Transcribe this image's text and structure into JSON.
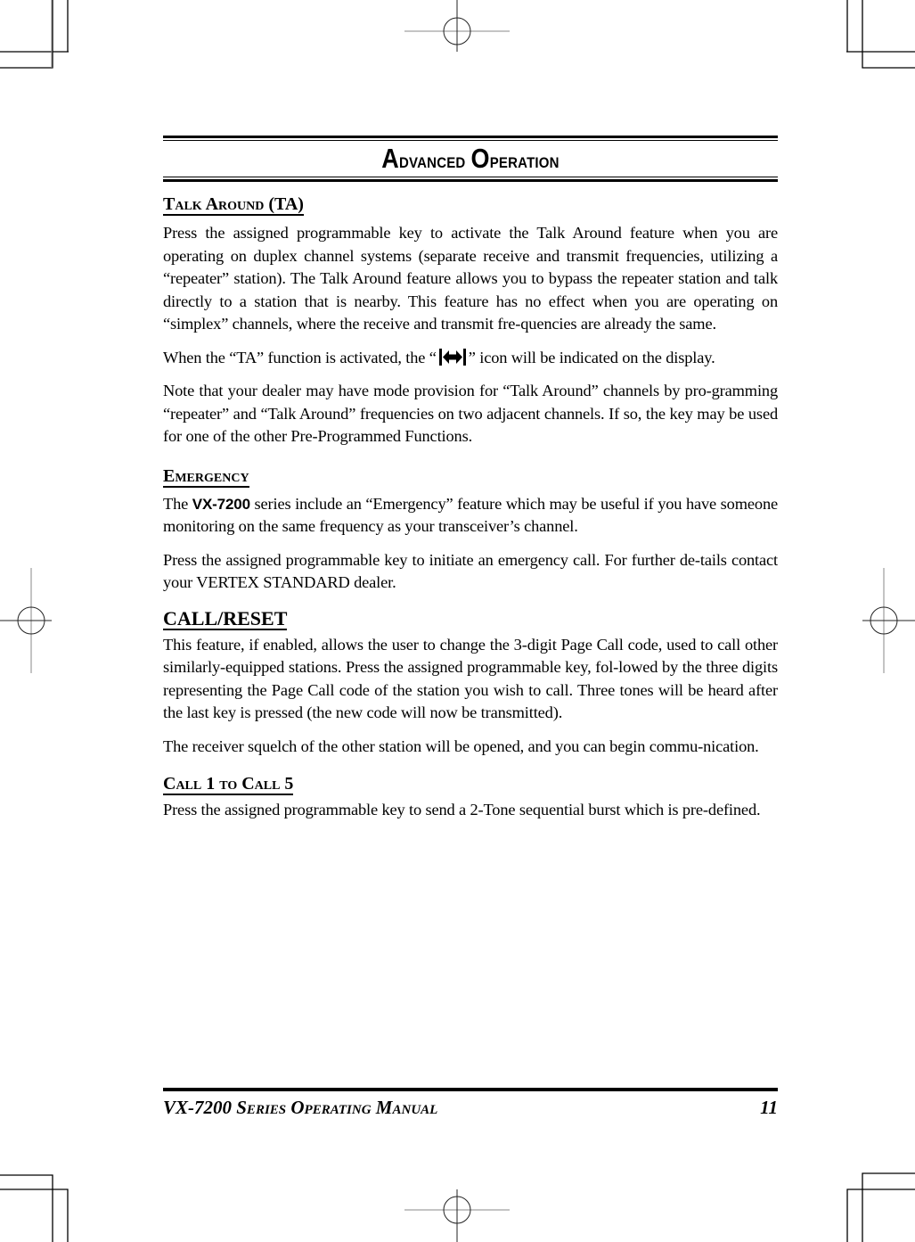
{
  "chapter": {
    "title_cap1": "A",
    "title_rest1": "dvanced ",
    "title_cap2": "O",
    "title_rest2": "peration"
  },
  "sections": {
    "talk_around": {
      "heading": "Talk Around (TA)",
      "para1": "Press the assigned programmable key to activate the Talk Around feature when you are operating on duplex channel systems (separate receive and transmit frequencies, utilizing a “repeater” station). The Talk Around feature allows you to bypass the repeater station and talk directly to a station that is nearby. This feature has no effect when you are operating on “simplex” channels, where the receive and transmit fre-quencies are already the same.",
      "para2_before": "When the “TA” function is activated, the “",
      "para2_icon": "talk-around-arrow-icon",
      "para2_after": "” icon will be indicated on the display.",
      "para3": "Note that your dealer may have mode provision for “Talk Around” channels by pro-gramming “repeater” and “Talk Around” frequencies on two adjacent channels. If so, the key may be used for one of the other Pre-Programmed Functions."
    },
    "emergency": {
      "heading": "Emergency",
      "para1_before": "The ",
      "para1_model": "VX-7200",
      "para1_after": " series include an “Emergency” feature which may be useful if you have someone monitoring on the same frequency as your transceiver’s channel.",
      "para2": "Press the assigned programmable key to initiate an emergency call. For further de-tails contact your VERTEX STANDARD dealer."
    },
    "call_reset": {
      "heading": "CALL/RESET",
      "para1": "This feature, if enabled, allows the user to change the 3-digit Page Call code, used to call other similarly-equipped stations. Press the assigned programmable key, fol-lowed by the three digits representing the Page Call code of the station you wish to call. Three tones will be heard after the last key is pressed (the new code will now be transmitted).",
      "para2": "The receiver squelch of the other station will be opened, and you can begin commu-nication."
    },
    "call_1_to_5": {
      "heading": "Call 1 to Call 5",
      "para1": "Press the assigned programmable key to send a 2-Tone sequential burst which is pre-defined."
    }
  },
  "footer": {
    "title": "VX-7200 Series Operating Manual",
    "page_number": "11"
  }
}
